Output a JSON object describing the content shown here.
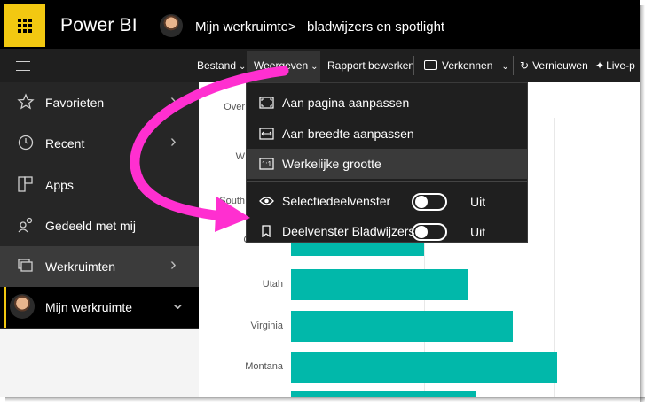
{
  "app": {
    "name": "Power BI"
  },
  "breadcrumb": {
    "workspace": "Mijn werkruimte",
    "separator": ">",
    "report": "bladwijzers en spotlight"
  },
  "toolbar": {
    "file": "Bestand",
    "view": "Weergeven",
    "edit_report": "Rapport bewerken",
    "explore": "Verkennen",
    "refresh": "Vernieuwen",
    "live": "Live-p"
  },
  "sidebar": {
    "items": [
      {
        "label": "Favorieten",
        "icon": "star-icon",
        "arrow": "›"
      },
      {
        "label": "Recent",
        "icon": "clock-icon",
        "arrow": "›"
      },
      {
        "label": "Apps",
        "icon": "apps-icon",
        "arrow": ""
      },
      {
        "label": "Gedeeld met mij",
        "icon": "shared-people-icon",
        "arrow": ""
      },
      {
        "label": "Werkruimten",
        "icon": "workspaces-icon",
        "arrow": "›"
      },
      {
        "label": "Mijn werkruimte",
        "icon": "avatar",
        "arrow": "⌄"
      }
    ]
  },
  "view_menu": {
    "items": [
      {
        "label": "Aan pagina aanpassen",
        "icon": "fit-page-icon"
      },
      {
        "label": "Aan breedte aanpassen",
        "icon": "fit-width-icon"
      },
      {
        "label": "Werkelijke grootte",
        "icon": "actual-size-icon"
      }
    ],
    "toggles": [
      {
        "label": "Selectiedeelvenster",
        "icon": "eye-icon",
        "state": "Uit",
        "on": false
      },
      {
        "label": "Deelvenster Bladwijzers",
        "icon": "bookmark-icon",
        "state": "Uit",
        "on": false
      }
    ]
  },
  "chart_data": {
    "type": "bar",
    "orientation": "horizontal",
    "categories": [
      "Over",
      "W",
      "South",
      "Colorado",
      "Utah",
      "Virginia",
      "Montana"
    ],
    "visible_tick_labels": [
      "Over",
      "W",
      "South",
      "Colorado",
      "Utah",
      "Virginia",
      "Montana"
    ],
    "values_relative": [
      null,
      null,
      null,
      0.3,
      0.4,
      0.5,
      0.6
    ],
    "colors": {
      "bar": "#01b8aa"
    }
  },
  "colors": {
    "accent": "#f2c811",
    "highlight": "#ff2fd0",
    "bar": "#01b8aa"
  }
}
